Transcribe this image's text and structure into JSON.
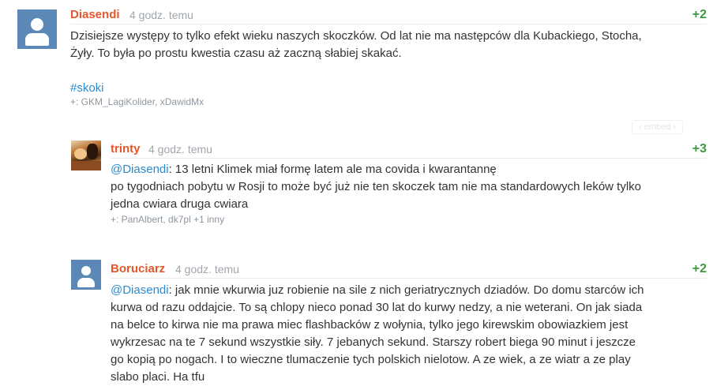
{
  "comments": [
    {
      "author": "Diasendi",
      "time": "4 godz. temu",
      "score": "+2",
      "lines": [
        "Dzisiejsze występy to tylko efekt wieku naszych skoczków. Od lat nie ma następców dla Kubackiego, Stocha,",
        "Żyły. To była po prostu kwestia czasu aż zaczną słabiej skakać."
      ],
      "tag": "#skoki",
      "plus": "+: GKM_LagiKolider, xDawidMx",
      "embed": "‹ embed ›"
    },
    {
      "author": "trinty",
      "time": "4 godz. temu",
      "score": "+3",
      "mention": "@Diasendi",
      "line1_rest": ": 13 letni Klimek miał formę latem ale ma covida i kwarantannę",
      "lines": [
        "po tygodniach pobytu w Rosji to może być już nie ten skoczek tam nie ma standardowych leków tylko",
        "jedna cwiara druga cwiara"
      ],
      "plus": "+: PanAlbert, dk7pl +1 inny"
    },
    {
      "author": "Boruciarz",
      "time": "4 godz. temu",
      "score": "+2",
      "mention": "@Diasendi",
      "line1_rest": ": jak mnie wkurwia juz robienie na sile z nich geriatrycznych dziadów. Do domu starców ich",
      "lines": [
        "kurwa od razu oddajcie. To są chlopy nieco ponad 30 lat do kurwy nedzy, a nie weterani. On jak siada",
        "na belce to kirwa nie ma prawa miec flashbacków z wołynia, tylko jego kirewskim obowiazkiem jest",
        "wykrzesac na te 7 sekund wszystkie siły. 7 jebanych sekund. Starszy robert biega 90 minut i jeszcze",
        "go kopią po nogach. I to wieczne tlumaczenie tych polskich nielotow. A ze wiek, a ze wiatr a ze play",
        "slabo placi. Ha tfu"
      ]
    }
  ]
}
